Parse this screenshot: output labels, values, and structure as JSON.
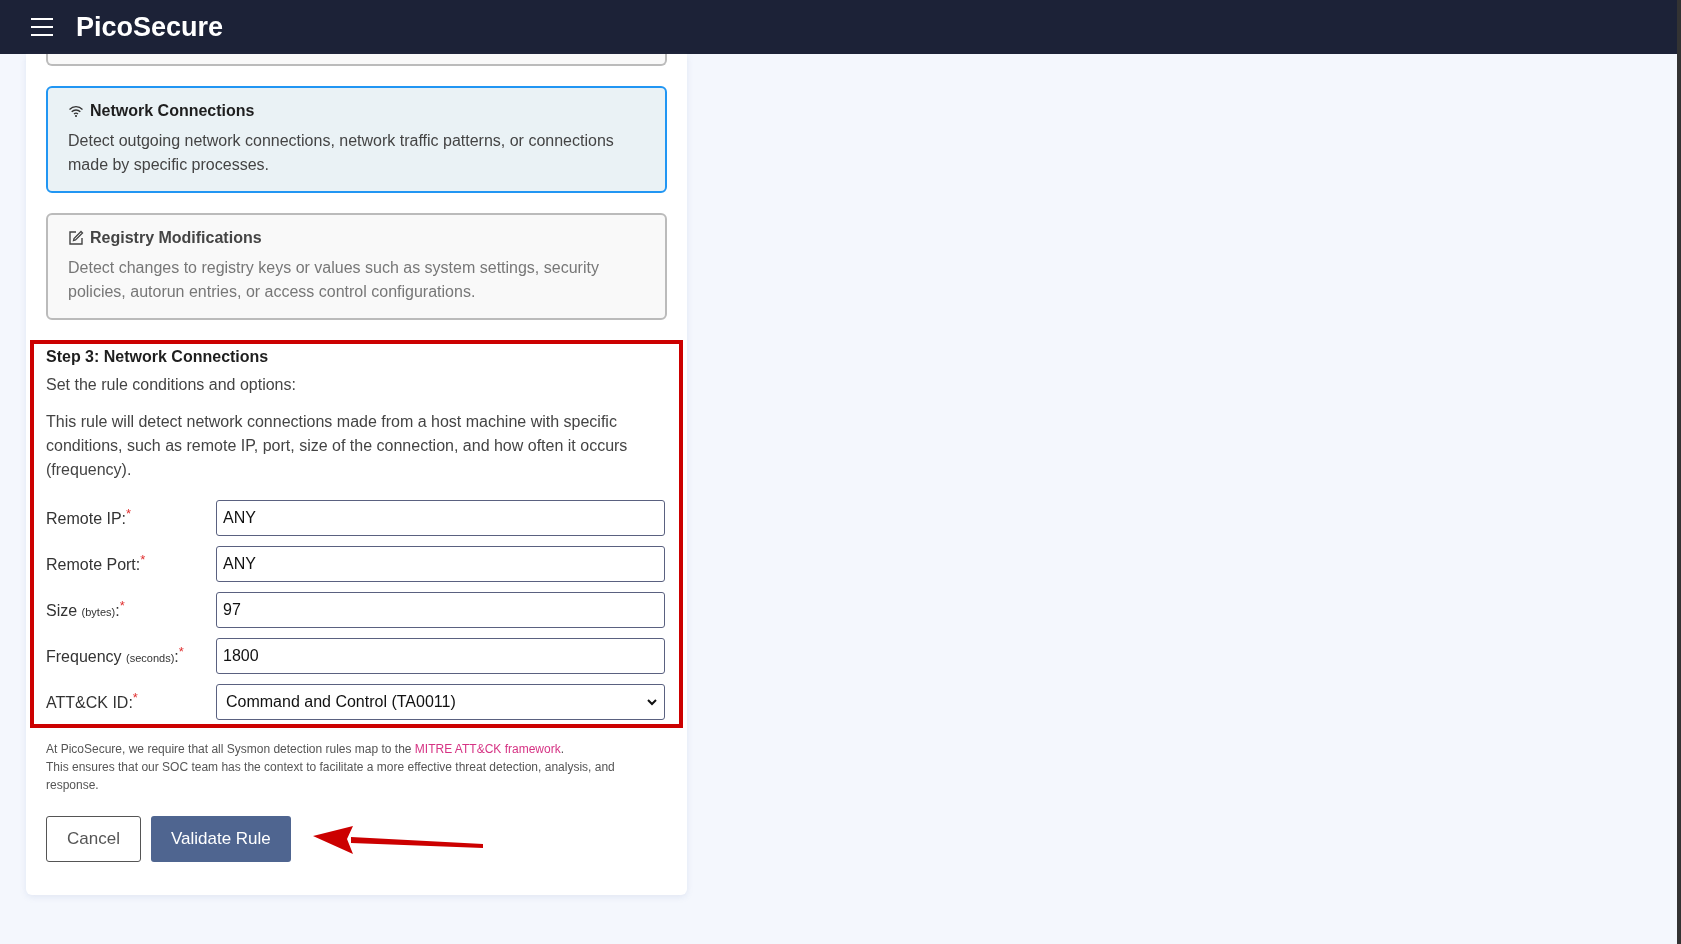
{
  "header": {
    "title": "PicoSecure"
  },
  "cards": [
    {
      "kind": "partial",
      "selected": false
    },
    {
      "kind": "network",
      "title": "Network Connections",
      "description": "Detect outgoing network connections, network traffic patterns, or connections made by specific processes.",
      "selected": true
    },
    {
      "kind": "registry",
      "title": "Registry Modifications",
      "description": "Detect changes to registry keys or values such as system settings, security policies, autorun entries, or access control configurations.",
      "selected": false
    }
  ],
  "step": {
    "title": "Step 3: Network Connections",
    "subtitle": "Set the rule conditions and options:",
    "description": "This rule will detect network connections made from a host machine with specific conditions, such as remote IP, port, size of the connection, and how often it occurs (frequency).",
    "fields": [
      {
        "kind": "text",
        "label": "Remote IP:",
        "required_mark": "*",
        "value": "ANY"
      },
      {
        "kind": "text",
        "label": "Remote Port:",
        "required_mark": "*",
        "value": "ANY"
      },
      {
        "kind": "text",
        "label": "Size",
        "unit": "(bytes)",
        "suffix": ":",
        "required_mark": "*",
        "value": "97"
      },
      {
        "kind": "text",
        "label": "Frequency",
        "unit": "(seconds)",
        "suffix": ":",
        "required_mark": "*",
        "value": "1800"
      },
      {
        "kind": "select",
        "label": "ATT&CK ID:",
        "required_mark": "*",
        "value": "Command and Control (TA0011)"
      }
    ]
  },
  "note": {
    "text_before": "At PicoSecure, we require that all Sysmon detection rules map to the ",
    "link": "MITRE ATT&CK framework",
    "text_after": ".",
    "line2": "This ensures that our SOC team has the context to facilitate a more effective threat detection, analysis, and response."
  },
  "buttons": [
    {
      "kind": "secondary",
      "label": "Cancel"
    },
    {
      "kind": "primary",
      "label": "Validate Rule"
    }
  ]
}
